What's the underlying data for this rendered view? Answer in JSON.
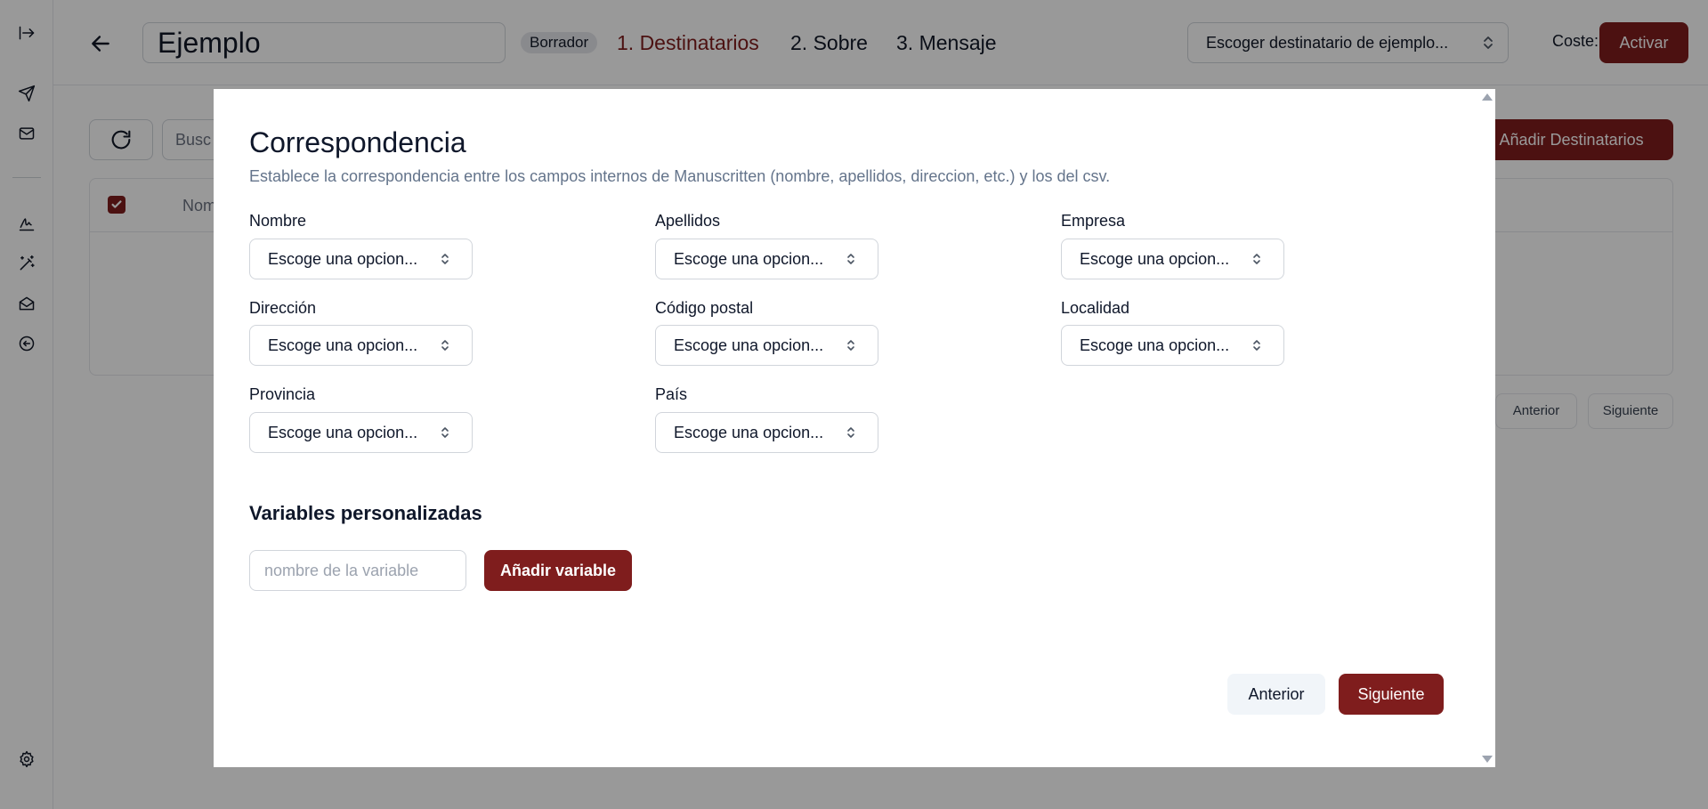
{
  "sidebar": {
    "icons": [
      "expand-sidebar-icon",
      "send-icon",
      "mail-icon",
      "signature-icon",
      "magic-wand-icon",
      "mail-open-icon",
      "circle-arrow-left-icon",
      "gear-icon"
    ]
  },
  "header": {
    "title_value": "Ejemplo",
    "status_badge": "Borrador",
    "steps": [
      {
        "label": "1. Destinatarios",
        "active": true
      },
      {
        "label": "2. Sobre",
        "active": false
      },
      {
        "label": "3. Mensaje",
        "active": false
      }
    ],
    "example_select": "Escoger destinatario de ejemplo...",
    "cost": "Coste: 0",
    "activate_label": "Activar"
  },
  "background": {
    "search_text": "Busc",
    "add_recipients_label": "+ Añadir Destinatarios",
    "column_name": "Nom",
    "pagination": {
      "prev": "Anterior",
      "next": "Siguiente"
    }
  },
  "modal": {
    "title": "Correspondencia",
    "description": "Establece la correspondencia entre los campos internos de Manuscritten (nombre, apellidos, direccion, etc.) y los del csv.",
    "select_placeholder": "Escoge una opcion...",
    "fields": [
      {
        "label": "Nombre",
        "value": "Escoge una opcion..."
      },
      {
        "label": "Apellidos",
        "value": "Escoge una opcion..."
      },
      {
        "label": "Empresa",
        "value": "Escoge una opcion..."
      },
      {
        "label": "Dirección",
        "value": "Escoge una opcion..."
      },
      {
        "label": "Código postal",
        "value": "Escoge una opcion..."
      },
      {
        "label": "Localidad",
        "value": "Escoge una opcion..."
      },
      {
        "label": "Provincia",
        "value": "Escoge una opcion..."
      },
      {
        "label": "País",
        "value": "Escoge una opcion..."
      }
    ],
    "custom_vars": {
      "title": "Variables personalizadas",
      "input_placeholder": "nombre de la variable",
      "add_label": "Añadir variable"
    },
    "prev_label": "Anterior",
    "next_label": "Siguiente"
  },
  "colors": {
    "accent": "#7f1d1d",
    "overlay": "rgba(0,0,0,0.4)",
    "description_text": "#64748b"
  }
}
